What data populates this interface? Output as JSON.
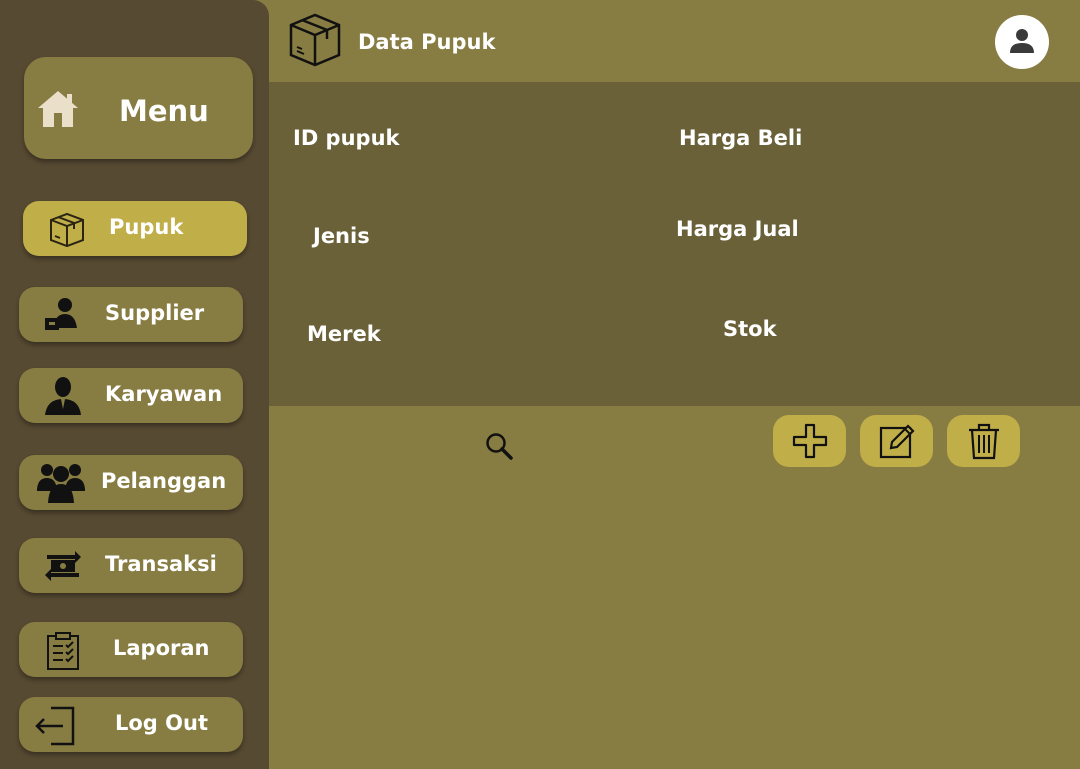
{
  "sidebar": {
    "menu_title": "Menu",
    "items": [
      {
        "label": "Pupuk",
        "icon": "box-icon"
      },
      {
        "label": "Supplier",
        "icon": "supplier-icon"
      },
      {
        "label": "Karyawan",
        "icon": "employee-icon"
      },
      {
        "label": "Pelanggan",
        "icon": "customers-icon"
      },
      {
        "label": "Transaksi",
        "icon": "transaction-icon"
      },
      {
        "label": "Laporan",
        "icon": "clipboard-icon"
      },
      {
        "label": "Log Out",
        "icon": "logout-icon"
      }
    ]
  },
  "header": {
    "title": "Data Pupuk",
    "icon": "box-icon",
    "avatar_icon": "user-icon"
  },
  "form": {
    "id_label": "ID pupuk",
    "jenis_label": "Jenis",
    "merek_label": "Merek",
    "harga_beli_label": "Harga Beli",
    "harga_jual_label": "Harga Jual",
    "stok_label": "Stok"
  },
  "toolbar": {
    "search_icon": "search-icon",
    "add_icon": "plus-icon",
    "edit_icon": "edit-icon",
    "delete_icon": "trash-icon"
  },
  "colors": {
    "sidebar_bg": "#574a32",
    "main_bg": "#877d43",
    "panel_bg": "#6a6139",
    "accent": "#c0ae49",
    "text": "#ffffff"
  }
}
